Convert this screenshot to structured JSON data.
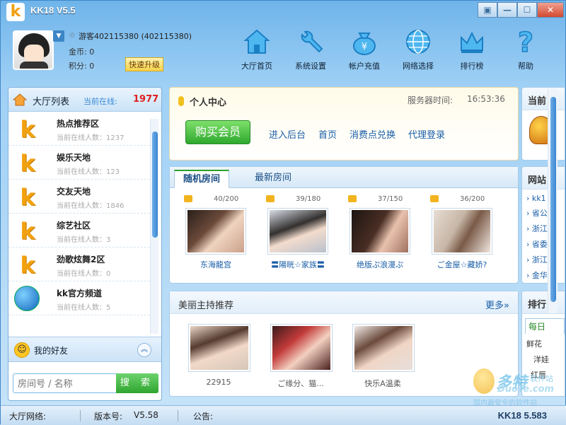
{
  "app": {
    "title": "KK18 V5.5",
    "logo_letter": "k"
  },
  "window_buttons": {
    "restore2": "▣",
    "minimize": "—",
    "maximize": "☐",
    "close": "✕"
  },
  "user": {
    "name": "游客402115380 (402115380)",
    "gold_label": "金币:",
    "gold_value": "0",
    "points_label": "积分:",
    "points_value": "0",
    "upgrade_label": "快速升级"
  },
  "topnav": [
    {
      "label": "大厅首页",
      "icon": "home-icon"
    },
    {
      "label": "系统设置",
      "icon": "wrench-icon"
    },
    {
      "label": "帐户充值",
      "icon": "money-bag-icon"
    },
    {
      "label": "网络选择",
      "icon": "globe-icon"
    },
    {
      "label": "排行榜",
      "icon": "crown-icon"
    },
    {
      "label": "帮助",
      "icon": "question-icon"
    }
  ],
  "hall": {
    "title": "大厅列表",
    "online_label": "当前在线:",
    "online_count": "1977",
    "items": [
      {
        "name": "热点推荐区",
        "count": "当前在线人数：1237"
      },
      {
        "name": "娱乐天地",
        "count": "当前在线人数：123"
      },
      {
        "name": "交友天地",
        "count": "当前在线人数：1846"
      },
      {
        "name": "综艺社区",
        "count": "当前在线人数：3"
      },
      {
        "name": "劲歌炫舞2区",
        "count": "当前在线人数：0"
      },
      {
        "name": "kk官方频道",
        "count": "当前在线人数：5"
      }
    ]
  },
  "friends": {
    "title": "我的好友",
    "collapse_icon": "︽"
  },
  "search": {
    "placeholder": "房间号 / 名称",
    "button": "搜 索"
  },
  "personal_center": {
    "title": "个人中心",
    "server_time_label": "服务器时间:",
    "server_time": "16:53:36",
    "buy_vip": "购买会员",
    "links": [
      "进入后台",
      "首页",
      "消费点兑换",
      "代理登录"
    ]
  },
  "rooms": {
    "tabs": [
      "随机房间",
      "最新房间"
    ],
    "items": [
      {
        "count": "40/200",
        "name": "东海龍宫"
      },
      {
        "count": "39/180",
        "name": "〓陽晄☆家族〓"
      },
      {
        "count": "37/150",
        "name": "绝版ぷ浪漫ぷ"
      },
      {
        "count": "36/200",
        "name": "ご金屋☆藏娇?"
      }
    ]
  },
  "hosts": {
    "title": "美丽主持推荐",
    "more": "更多»",
    "items": [
      {
        "name": "22915"
      },
      {
        "name": "ご缘分、猫..."
      },
      {
        "name": "快乐A温柔"
      }
    ]
  },
  "right_column": {
    "current_title": "当前",
    "site_title": "网站",
    "site_lines": [
      "› kk1",
      "› 省公",
      "› 浙江",
      "› 省委",
      "› 浙江",
      "› 金华"
    ],
    "rank_title": "排行",
    "rank_tab": "每日",
    "rank_lines": [
      "鲜花",
      "洋娃",
      "红唇"
    ]
  },
  "status": {
    "network_label": "大厅网络:",
    "version_label": "版本号:",
    "version": "V5.58",
    "notice_label": "公告:",
    "build": "KK18 5.583"
  },
  "watermark": {
    "brand": "多特",
    "brand2": "软件站",
    "domain": "DuoTe.com",
    "slogan": "国内最安全的软件站"
  },
  "colors": {
    "accent_blue": "#3b86d0",
    "online_red": "#e02020",
    "green_button": "#2ea82e",
    "link_blue": "#1a5ea8"
  }
}
